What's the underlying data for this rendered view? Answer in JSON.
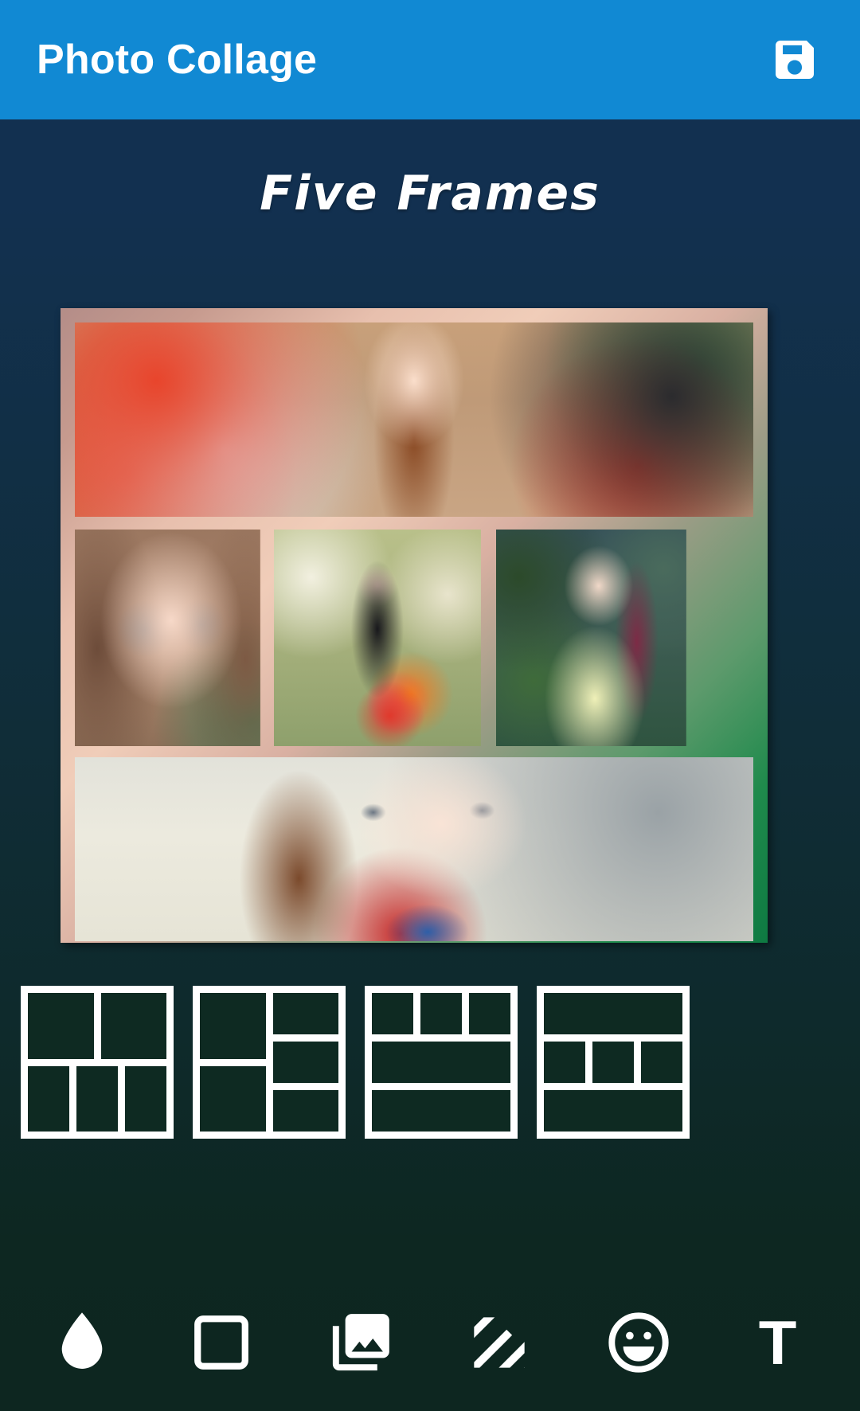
{
  "actionbar": {
    "title": "Photo Collage",
    "save_icon": "save-floppy-icon",
    "background_color": "#1189d3",
    "text_color": "#ffffff"
  },
  "frame": {
    "title": "Five Frames",
    "count": 5
  },
  "background": {
    "gradient_top": "#123050",
    "gradient_bottom": "#0d2620"
  },
  "collage": {
    "border_gradient_start": "#b48d88",
    "border_gradient_mid": "#f0cdb9",
    "border_gradient_end": "#0e7a42",
    "layout_name": "five-frames-1-3-1",
    "cells": [
      {
        "index": 1,
        "name": "collage-cell-top",
        "position": "top-wide",
        "description": "smiling woman with long auburn hair, colorful blurred shop background"
      },
      {
        "index": 2,
        "name": "collage-cell-middle-left",
        "position": "middle-left",
        "description": "close-up portrait of woman with grey-blue eyes and brown hair"
      },
      {
        "index": 3,
        "name": "collage-cell-middle-center",
        "position": "middle-center",
        "description": "woman on a rope swing in red skirt holding a bouquet of flowers"
      },
      {
        "index": 4,
        "name": "collage-cell-middle-right",
        "position": "middle-right",
        "description": "woman in a pale yellow ao dai looking upward, green foliage behind"
      },
      {
        "index": 5,
        "name": "collage-cell-bottom",
        "position": "bottom-wide",
        "description": "close-up of blue-eyed woman holding a red-white-blue knit scarf"
      }
    ]
  },
  "layout_strip": {
    "selected_index": 3,
    "thumbs": [
      {
        "name": "layout-thumb-1",
        "label": "2 over 3",
        "structure": "rows",
        "rows": [
          2,
          3
        ]
      },
      {
        "name": "layout-thumb-2",
        "label": "left 2 / right 3",
        "structure": "columns",
        "columns": [
          2,
          3
        ]
      },
      {
        "name": "layout-thumb-3",
        "label": "3 over 1 over 1",
        "structure": "rows",
        "rows": [
          3,
          1,
          1
        ]
      },
      {
        "name": "layout-thumb-4",
        "label": "1 over 3 over 1",
        "structure": "rows",
        "rows": [
          1,
          3,
          1
        ]
      }
    ],
    "cell_color": "#0e2a22",
    "outline_color": "#ffffff"
  },
  "toolbar": {
    "items": [
      {
        "name": "tool-filter",
        "icon": "water-drop-icon",
        "label": "Filter"
      },
      {
        "name": "tool-frame",
        "icon": "square-frame-icon",
        "label": "Frame"
      },
      {
        "name": "tool-gallery",
        "icon": "photo-library-icon",
        "label": "Gallery"
      },
      {
        "name": "tool-pattern",
        "icon": "diagonal-stripes-icon",
        "label": "Pattern"
      },
      {
        "name": "tool-sticker",
        "icon": "smiley-face-icon",
        "label": "Sticker"
      },
      {
        "name": "tool-text",
        "icon": "text-t-icon",
        "label": "T"
      }
    ],
    "icon_color": "#ffffff"
  }
}
